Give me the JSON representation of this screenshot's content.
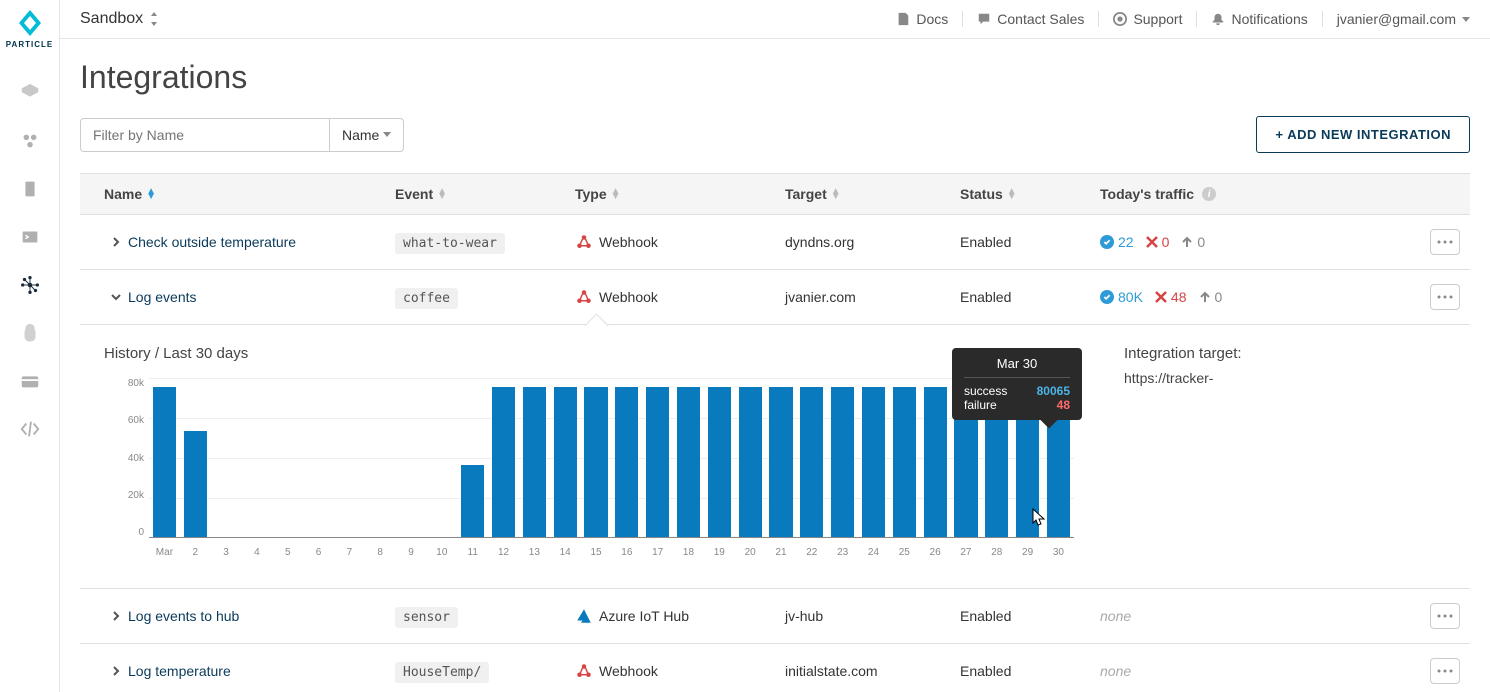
{
  "brand": "PARTICLE",
  "breadcrumb": "Sandbox",
  "top_links": {
    "docs": "Docs",
    "contact": "Contact Sales",
    "support": "Support",
    "notifications": "Notifications"
  },
  "user_email": "jvanier@gmail.com",
  "page_title": "Integrations",
  "filter": {
    "placeholder": "Filter by Name",
    "dropdown": "Name"
  },
  "add_button": "+ ADD NEW INTEGRATION",
  "columns": {
    "name": "Name",
    "event": "Event",
    "type": "Type",
    "target": "Target",
    "status": "Status",
    "traffic": "Today's traffic"
  },
  "rows": [
    {
      "expanded": false,
      "name": "Check outside temperature",
      "event": "what-to-wear",
      "type": "Webhook",
      "type_icon": "webhook-icon",
      "target": "dyndns.org",
      "status": "Enabled",
      "traffic": {
        "success": "22",
        "error": "0",
        "sleep": "0"
      }
    },
    {
      "expanded": true,
      "name": "Log events",
      "event": "coffee",
      "type": "Webhook",
      "type_icon": "webhook-icon",
      "target": "jvanier.com",
      "status": "Enabled",
      "traffic": {
        "success": "80K",
        "error": "48",
        "sleep": "0"
      }
    },
    {
      "expanded": false,
      "name": "Log events to hub",
      "event": "sensor",
      "type": "Azure IoT Hub",
      "type_icon": "azure-icon",
      "target": "jv-hub",
      "status": "Enabled",
      "traffic": {
        "none": "none"
      }
    },
    {
      "expanded": false,
      "name": "Log temperature",
      "event": "HouseTemp/",
      "type": "Webhook",
      "type_icon": "webhook-icon",
      "target": "initialstate.com",
      "status": "Enabled",
      "traffic": {
        "none": "none"
      }
    }
  ],
  "expanded_panel": {
    "history_title": "History / Last 30 days",
    "target_label": "Integration target:",
    "target_url": "https://tracker-",
    "tooltip": {
      "date": "Mar 30",
      "success_label": "success",
      "success_value": "80065",
      "failure_label": "failure",
      "failure_value": "48"
    }
  },
  "chart_data": {
    "type": "bar",
    "ylabel": "",
    "ylim": [
      0,
      90000
    ],
    "y_ticks": [
      "0",
      "20k",
      "40k",
      "60k",
      "80k"
    ],
    "categories": [
      "Mar",
      "2",
      "3",
      "4",
      "5",
      "6",
      "7",
      "8",
      "9",
      "10",
      "11",
      "12",
      "13",
      "14",
      "15",
      "16",
      "17",
      "18",
      "19",
      "20",
      "21",
      "22",
      "23",
      "24",
      "25",
      "26",
      "27",
      "28",
      "29",
      "30"
    ],
    "values": [
      85000,
      60000,
      0,
      0,
      0,
      0,
      0,
      0,
      0,
      0,
      41000,
      85000,
      85000,
      85000,
      85000,
      85000,
      85000,
      85000,
      85000,
      85000,
      85000,
      85000,
      85000,
      85000,
      85000,
      85000,
      85000,
      85000,
      85000,
      80000
    ],
    "title": "History / Last 30 days"
  }
}
